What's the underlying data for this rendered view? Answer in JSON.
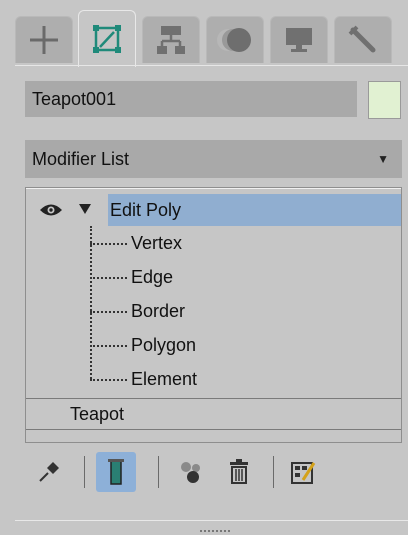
{
  "tabs": [
    {
      "icon": "create-plus-icon"
    },
    {
      "icon": "modify-icon",
      "active": true
    },
    {
      "icon": "hierarchy-icon"
    },
    {
      "icon": "motion-icon"
    },
    {
      "icon": "display-icon"
    },
    {
      "icon": "utilities-wrench-icon"
    }
  ],
  "object_name": "Teapot001",
  "object_color": "#e1f1d2",
  "modifier_list": {
    "label": "Modifier List"
  },
  "stack": {
    "modifier": "Edit Poly",
    "sub_objects": [
      "Vertex",
      "Edge",
      "Border",
      "Polygon",
      "Element"
    ],
    "base_object": "Teapot"
  },
  "toolbar": {
    "icons": [
      "pin-stack-icon",
      "show-end-result-icon",
      "make-unique-icon",
      "remove-modifier-icon",
      "configure-modifier-sets-icon"
    ]
  },
  "colors": {
    "selection": "#90aed0",
    "panel": "#c6c6c6",
    "field": "#a9a9a9"
  }
}
